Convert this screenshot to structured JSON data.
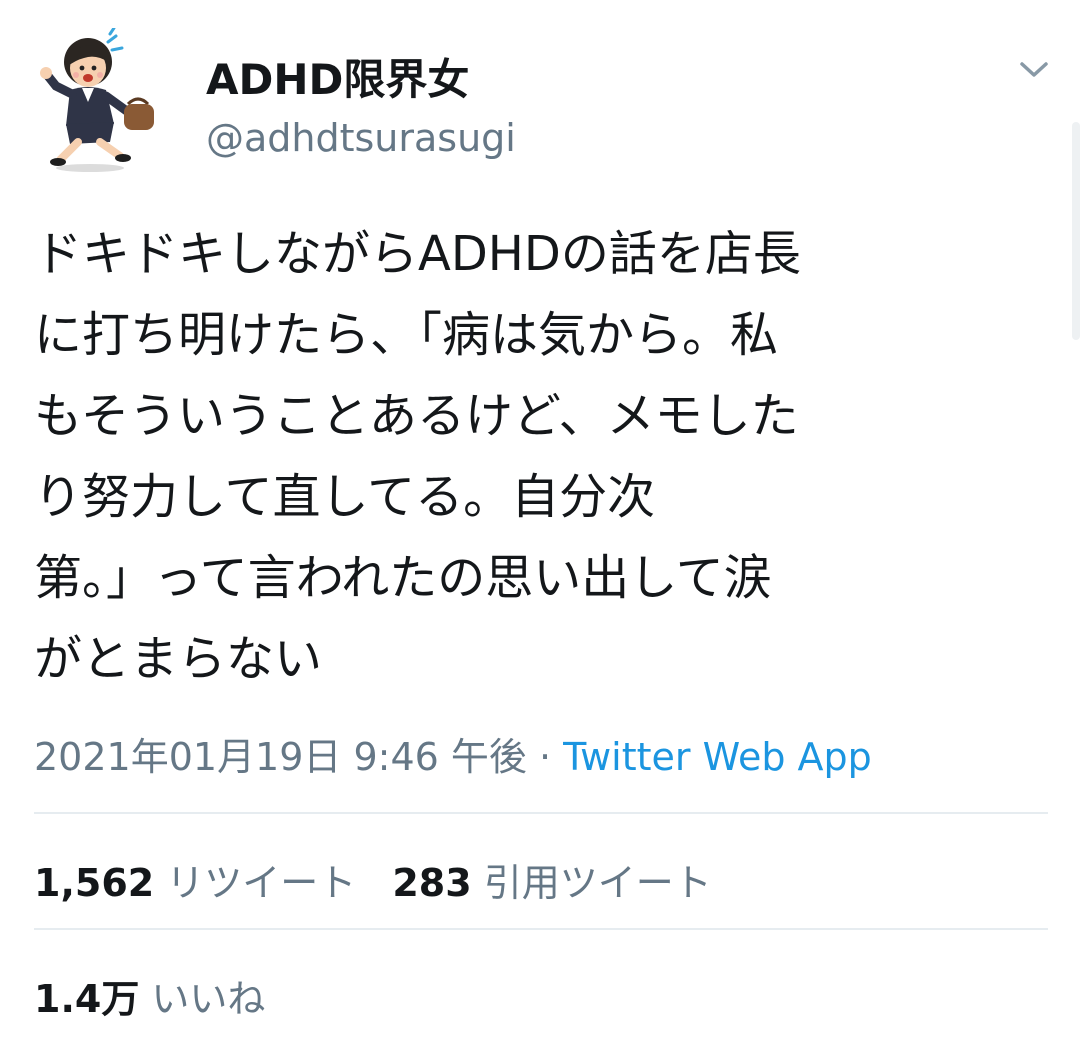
{
  "user": {
    "display_name": "ADHD限界女",
    "handle": "@adhdtsurasugi",
    "avatar_icon": "running-businesswoman-illustration"
  },
  "more_icon": "chevron-down-icon",
  "tweet": {
    "text": "ドキドキしながらADHDの話を店長\nに打ち明けたら、「病は気から。私\nもそういうことあるけど、メモした\nり努力して直してる。自分次\n第。」って言われたの思い出して涙\nがとまらない",
    "timestamp": "2021年01月19日 9:46 午後",
    "separator": " · ",
    "source": "Twitter Web App"
  },
  "stats": {
    "retweets_count": "1,562",
    "retweets_label": "リツイート",
    "quotes_count": "283",
    "quotes_label": "引用ツイート",
    "likes_count": "1.4万",
    "likes_label": "いいね"
  },
  "colors": {
    "text": "#14171a",
    "secondary": "#657786",
    "link": "#1b95e0",
    "divider": "#e6ecf0"
  }
}
